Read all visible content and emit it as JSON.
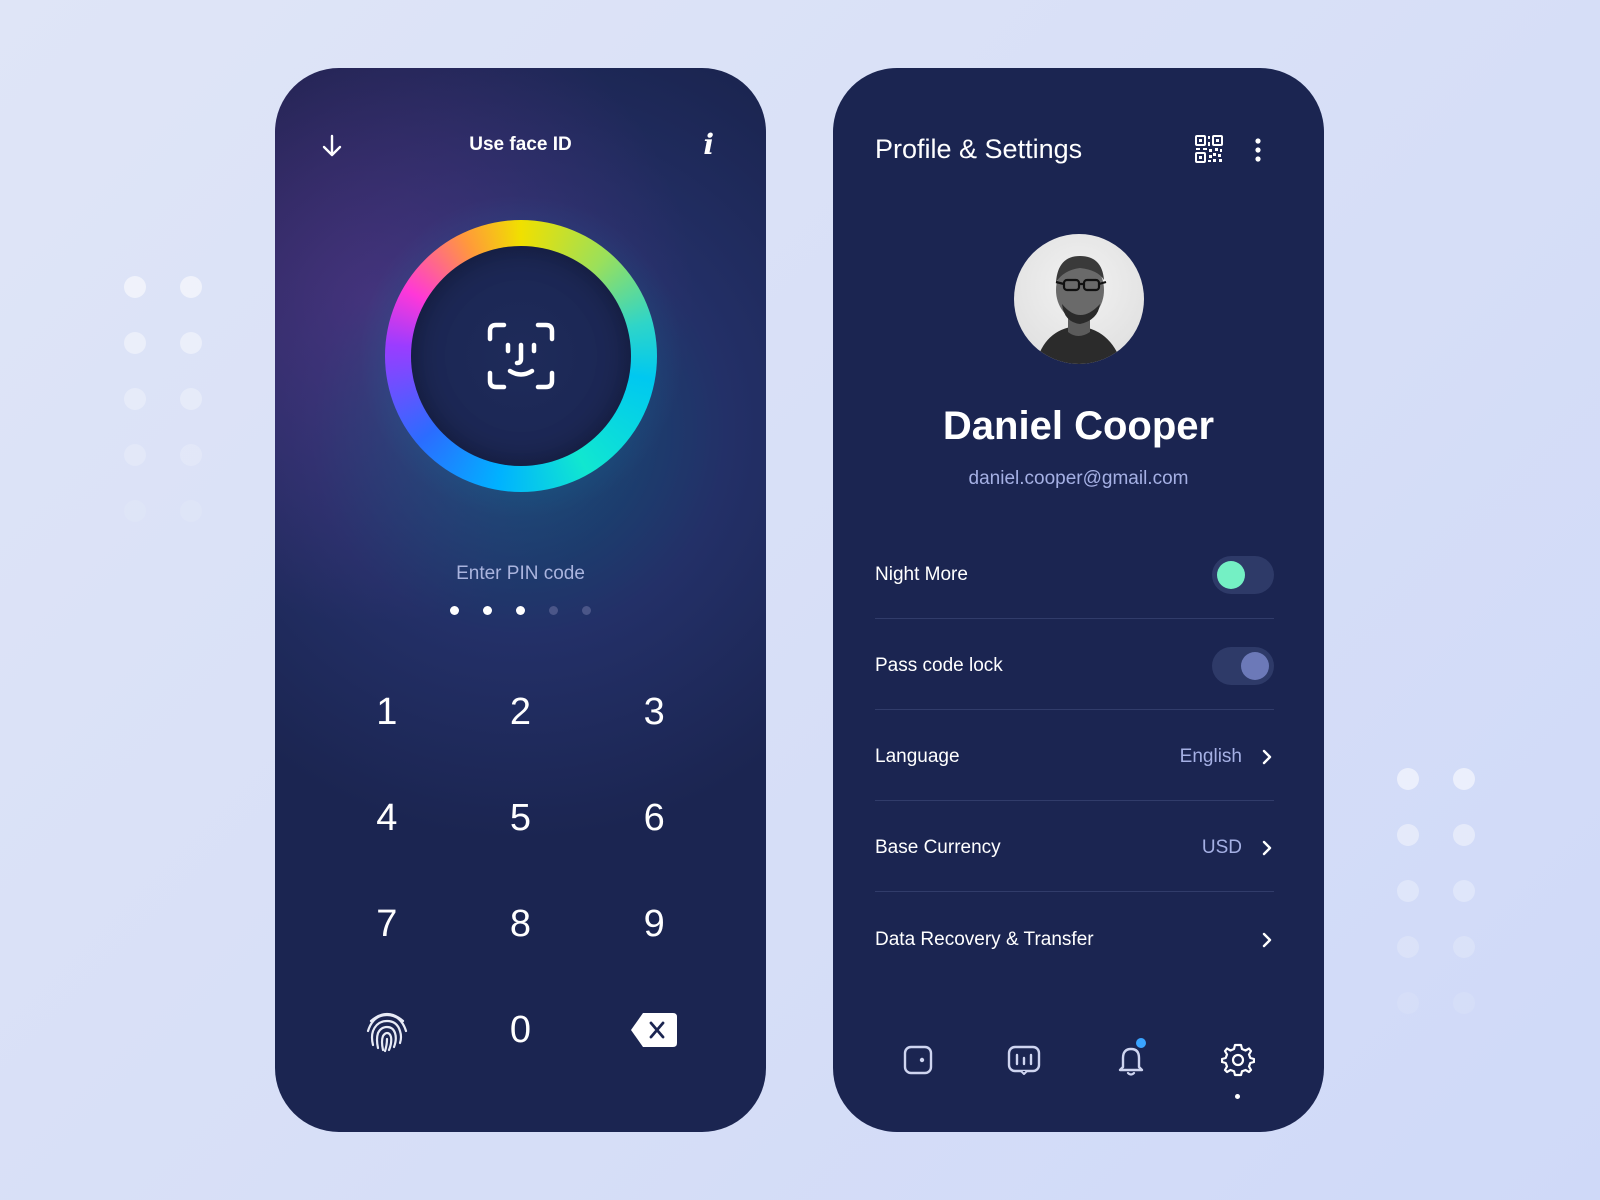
{
  "colors": {
    "accent_toggle": "#74f0c4",
    "panel_bg": "#1b2551",
    "muted_text": "#a5b0e4"
  },
  "left_screen": {
    "back_icon": "arrow-down-icon",
    "title": "Use face ID",
    "info_label": "i",
    "face_icon": "face-id-icon",
    "pin_label": "Enter PIN code",
    "pin_entered": 3,
    "pin_length": 5,
    "keys": [
      "1",
      "2",
      "3",
      "4",
      "5",
      "6",
      "7",
      "8",
      "9",
      "0"
    ],
    "fingerprint_icon": "fingerprint-icon",
    "delete_icon": "backspace-icon"
  },
  "right_screen": {
    "title": "Profile & Settings",
    "qr_icon": "qr-code-icon",
    "more_icon": "more-vertical-icon",
    "profile": {
      "name": "Daniel Cooper",
      "email": "daniel.cooper@gmail.com"
    },
    "settings": [
      {
        "label": "Night More",
        "type": "toggle",
        "state": "on"
      },
      {
        "label": "Pass code lock",
        "type": "toggle",
        "state": "off"
      },
      {
        "label": "Language",
        "type": "link",
        "value": "English"
      },
      {
        "label": "Base Currency",
        "type": "link",
        "value": "USD"
      },
      {
        "label": "Data Recovery & Transfer",
        "type": "link",
        "value": ""
      }
    ],
    "tabs": [
      {
        "icon": "wallet-icon"
      },
      {
        "icon": "stats-icon"
      },
      {
        "icon": "bell-icon",
        "has_badge": true
      },
      {
        "icon": "gear-icon",
        "active": true
      }
    ]
  }
}
